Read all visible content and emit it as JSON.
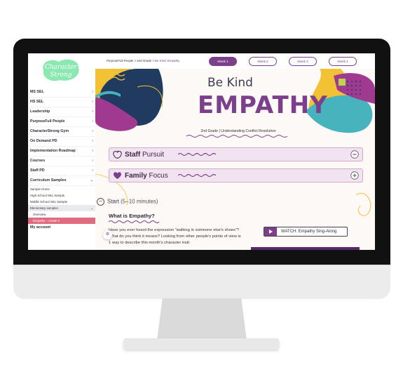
{
  "sidebar": {
    "logo_text": [
      "Character",
      "Strong"
    ],
    "items": [
      {
        "label": "MS SEL",
        "chevron": "›"
      },
      {
        "label": "HS SEL",
        "chevron": "›"
      },
      {
        "label": "Leadership",
        "chevron": "›"
      },
      {
        "label": "PurposeFull People",
        "chevron": "›"
      },
      {
        "label": "CharacterStrong Gym",
        "chevron": "›"
      },
      {
        "label": "On Demand PD",
        "chevron": "›"
      },
      {
        "label": "Implementation Roadmap",
        "chevron": "›"
      },
      {
        "label": "Courses",
        "chevron": "›"
      },
      {
        "label": "Staff PD",
        "chevron": "›"
      },
      {
        "label": "Curriculum Samples",
        "chevron": "⌄"
      }
    ],
    "sub_items": [
      {
        "label": "Sample Home"
      },
      {
        "label": "High School SEL Sample"
      },
      {
        "label": "Middle School SEL Sample"
      },
      {
        "label": "Elementary samples",
        "chevron": "⌄"
      },
      {
        "label": "Overview"
      },
      {
        "label": "Empathy – Grade 2"
      }
    ],
    "account": "My account"
  },
  "breadcrumb": {
    "items": [
      "PurposeFull People",
      "2nd Grade",
      "Be Kind: Empathy"
    ],
    "separator": ">"
  },
  "weeks": [
    "Week 1",
    "Week 2",
    "Week 3",
    "Week 4"
  ],
  "hero": {
    "title_small": "Be Kind",
    "title_big": "EMPATHY",
    "subtitle": "2nd Grade | Understanding Conflict Resolution"
  },
  "cards": [
    {
      "strong": "Staff",
      "rest": " Pursuit"
    },
    {
      "strong": "Family",
      "rest": " Focus"
    }
  ],
  "section": {
    "start_label": "Start",
    "duration": "(5–10 minutes)",
    "question": "What is Empathy?",
    "paragraph": "Have you ever heard the expression “walking in someone else's shoes”? What do you think it means? Looking from other people's points of view is 1 way to describe this month's character trait:",
    "watch_label": "WATCH: Empathy Sing-Along"
  },
  "colors": {
    "purple": "#7b3f8c",
    "navy": "#213a60",
    "magenta": "#a03a91",
    "yellow": "#f3c234",
    "teal": "#47b3bd",
    "mint": "#8ae8b0",
    "pink_active": "#e06a7e"
  },
  "icons": {
    "staff": "apple-heart-icon",
    "family": "heart-house-icon",
    "expand": "plus-circle-icon",
    "collapse": "minus-circle-icon",
    "watch": "play-icon",
    "fab": "accessibility-icon"
  }
}
